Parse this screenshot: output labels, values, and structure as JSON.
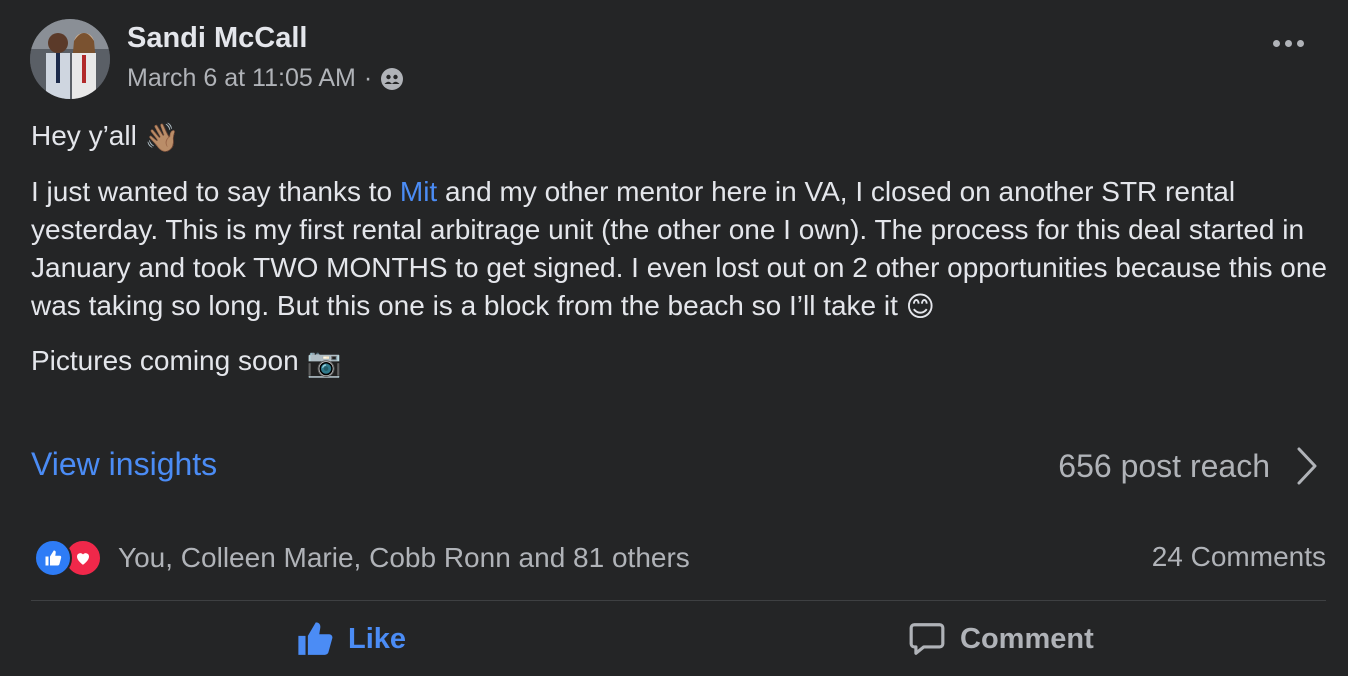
{
  "post": {
    "author": "Sandi McCall",
    "timestamp": "March 6 at 11:05 AM",
    "separator": "·",
    "audience_icon": "friends-icon",
    "greeting": "Hey y’all",
    "greeting_emoji": "👋🏽",
    "para2_before": "I just wanted to say thanks to ",
    "mention": "Mit",
    "para2_after": " and my other mentor here in VA, I closed on another STR rental yesterday. This is my first rental arbitrage unit (the other one I own). The process for this deal started in January and took TWO MONTHS to get signed. I even lost out on 2 other opportunities because this one was taking so long. But this one is a block from the beach so I’ll take it ",
    "para2_emoji": "😊",
    "para3": "Pictures coming soon ",
    "para3_emoji": "📷"
  },
  "insights": {
    "view_label": "View insights",
    "reach": "656 post reach"
  },
  "engagement": {
    "reactors": "You, Colleen Marie, Cobb Ronn and 81 others",
    "comments": "24 Comments"
  },
  "actions": {
    "like": "Like",
    "comment": "Comment"
  },
  "colors": {
    "background": "#242526",
    "accent": "#4b8cf5",
    "like_reaction": "#2e7cf6",
    "love_reaction": "#f0284a",
    "secondary_text": "#b0b3b8"
  }
}
